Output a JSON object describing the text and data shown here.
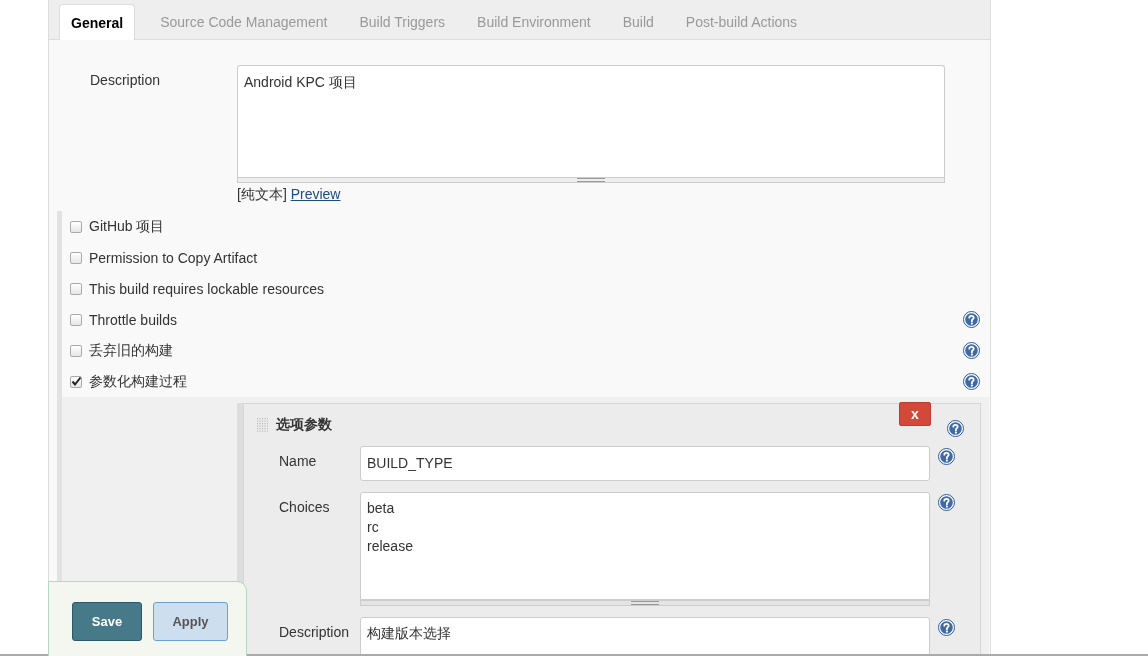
{
  "tabs": [
    {
      "label": "General",
      "selected": true
    },
    {
      "label": "Source Code Management",
      "selected": false
    },
    {
      "label": "Build Triggers",
      "selected": false
    },
    {
      "label": "Build Environment",
      "selected": false
    },
    {
      "label": "Build",
      "selected": false
    },
    {
      "label": "Post-build Actions",
      "selected": false
    }
  ],
  "description": {
    "label": "Description",
    "value": "Android KPC 项目",
    "format": "[纯文本]",
    "preview_link": "Preview"
  },
  "options": [
    {
      "label": "GitHub 项目",
      "checked": false,
      "help": false
    },
    {
      "label": "Permission to Copy Artifact",
      "checked": false,
      "help": false
    },
    {
      "label": "This build requires lockable resources",
      "checked": false,
      "help": false
    },
    {
      "label": "Throttle builds",
      "checked": false,
      "help": true
    },
    {
      "label": "丢弃旧的构建",
      "checked": false,
      "help": true
    },
    {
      "label": "参数化构建过程",
      "checked": true,
      "help": true
    }
  ],
  "parameter": {
    "title": "选项参数",
    "delete_button": "x",
    "fields": [
      {
        "label": "Name",
        "kind": "input",
        "value": "BUILD_TYPE"
      },
      {
        "label": "Choices",
        "kind": "textarea",
        "value": "beta\nrc\nrelease"
      },
      {
        "label": "Description",
        "kind": "textarea",
        "value": "构建版本选择"
      }
    ]
  },
  "buttons": [
    {
      "label": "Save",
      "kind": "primary"
    },
    {
      "label": "Apply",
      "kind": "secondary"
    }
  ]
}
